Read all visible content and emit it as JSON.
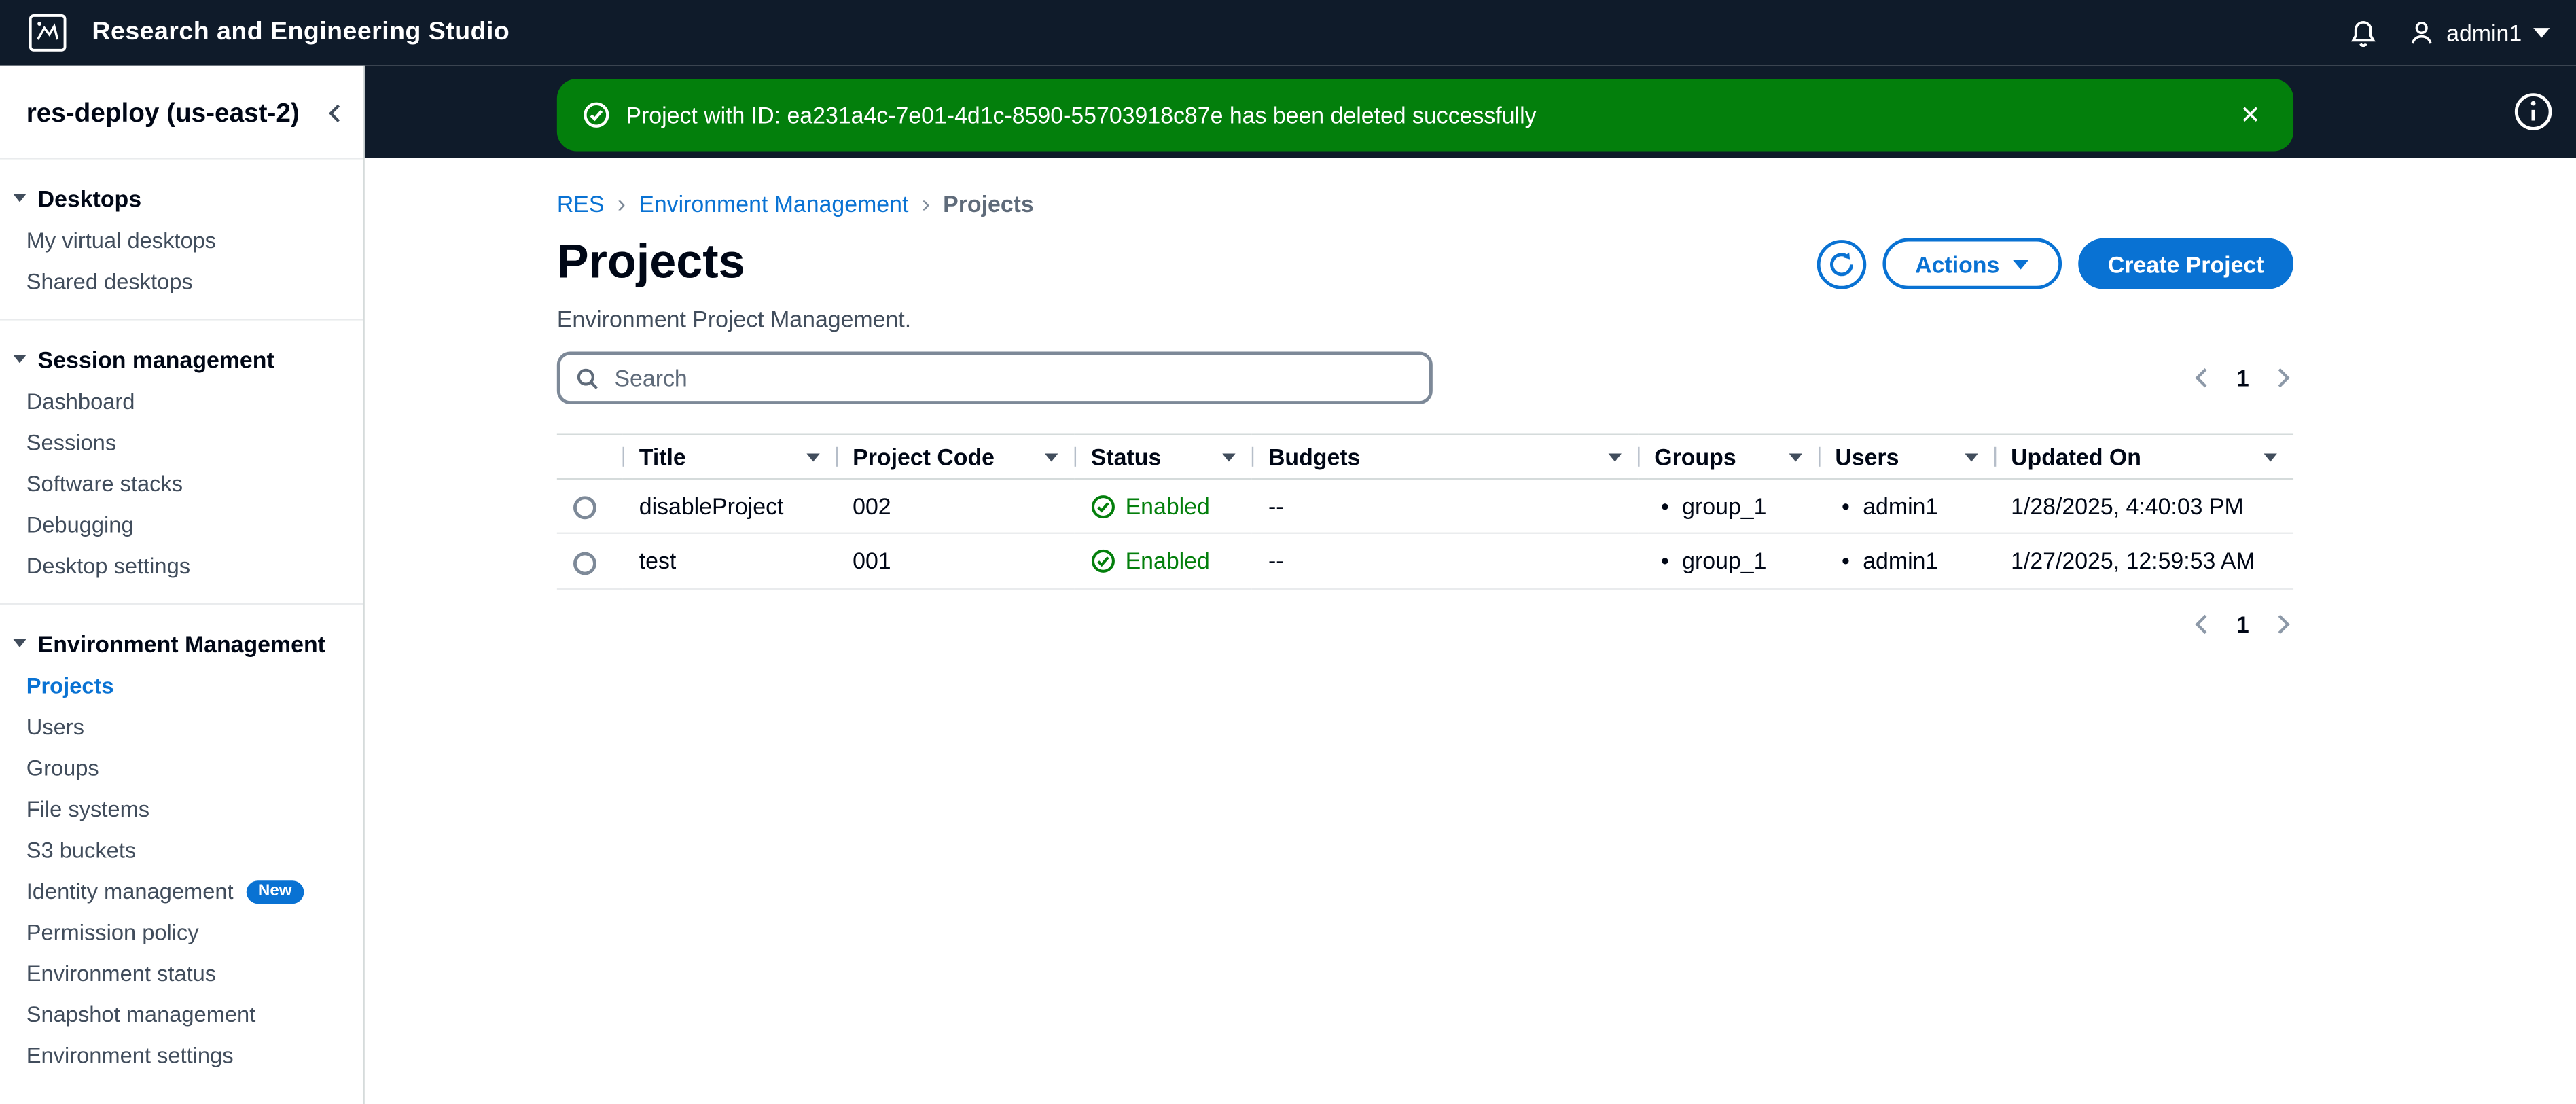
{
  "app": {
    "title": "Research and Engineering Studio",
    "user": "admin1"
  },
  "sidebar": {
    "title": "res-deploy (us-east-2)",
    "sections": [
      {
        "label": "Desktops",
        "items": [
          {
            "label": "My virtual desktops"
          },
          {
            "label": "Shared desktops"
          }
        ]
      },
      {
        "label": "Session management",
        "items": [
          {
            "label": "Dashboard"
          },
          {
            "label": "Sessions"
          },
          {
            "label": "Software stacks"
          },
          {
            "label": "Debugging"
          },
          {
            "label": "Desktop settings"
          }
        ]
      },
      {
        "label": "Environment Management",
        "items": [
          {
            "label": "Projects"
          },
          {
            "label": "Users"
          },
          {
            "label": "Groups"
          },
          {
            "label": "File systems"
          },
          {
            "label": "S3 buckets"
          },
          {
            "label": "Identity management",
            "badge": "New"
          },
          {
            "label": "Permission policy"
          },
          {
            "label": "Environment status"
          },
          {
            "label": "Snapshot management"
          },
          {
            "label": "Environment settings"
          }
        ]
      }
    ]
  },
  "flash": {
    "message": "Project with ID: ea231a4c-7e01-4d1c-8590-55703918c87e has been deleted successfully"
  },
  "breadcrumbs": {
    "items": [
      "RES",
      "Environment Management",
      "Projects"
    ]
  },
  "page": {
    "title": "Projects",
    "description": "Environment Project Management.",
    "actions": "Actions",
    "create": "Create Project"
  },
  "search": {
    "placeholder": "Search"
  },
  "pagination": {
    "current": "1"
  },
  "table": {
    "columns": [
      "Title",
      "Project Code",
      "Status",
      "Budgets",
      "Groups",
      "Users",
      "Updated On"
    ],
    "rows": [
      {
        "title": "disableProject",
        "code": "002",
        "status": "Enabled",
        "budgets": "--",
        "group": "group_1",
        "user": "admin1",
        "updated": "1/28/2025, 4:40:03 PM"
      },
      {
        "title": "test",
        "code": "001",
        "status": "Enabled",
        "budgets": "--",
        "group": "group_1",
        "user": "admin1",
        "updated": "1/27/2025, 12:59:53 AM"
      }
    ]
  },
  "colors": {
    "accent": "#0972d3",
    "success": "#037f0c",
    "header_bg": "#0f1b2a",
    "link": "#0972d3"
  }
}
